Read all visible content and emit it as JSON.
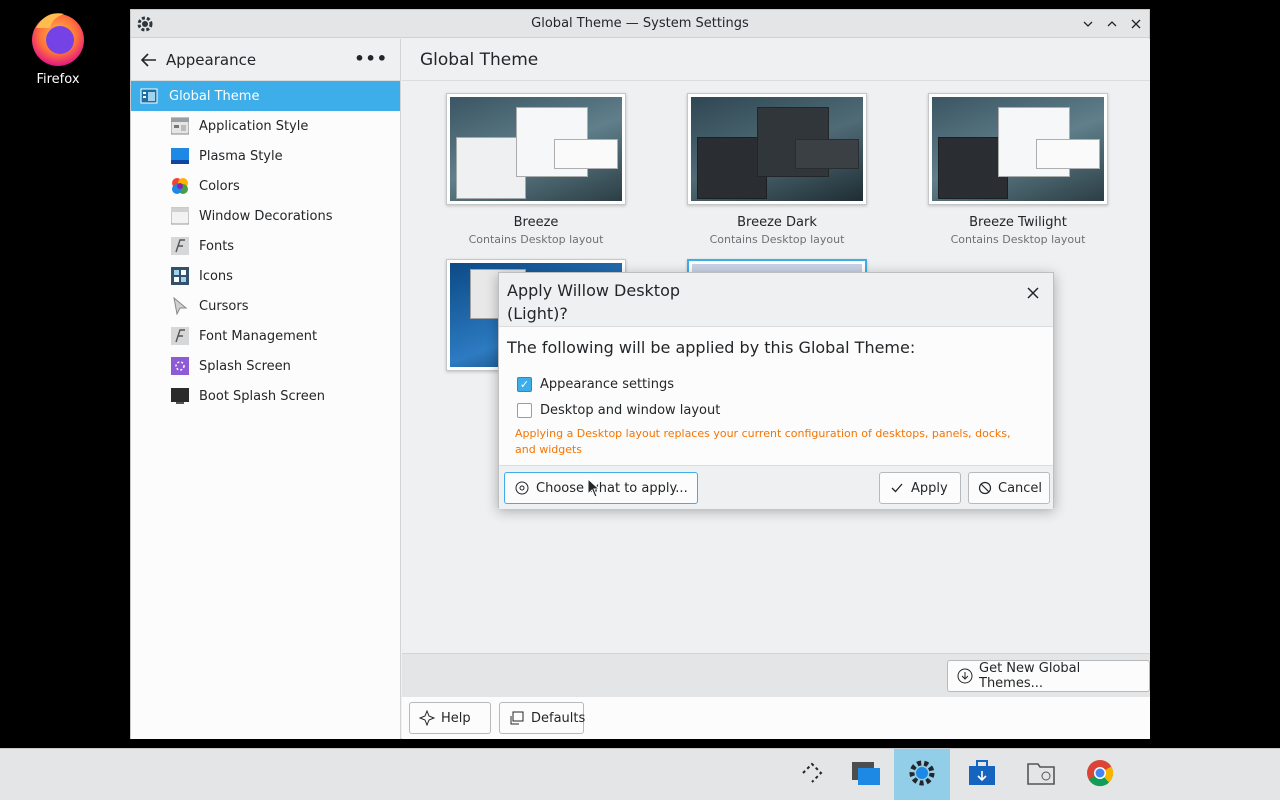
{
  "desktop": {
    "firefox_label": "Firefox"
  },
  "window": {
    "title": "Global Theme — System Settings",
    "controls": [
      "minimize",
      "maximize",
      "close"
    ]
  },
  "sidebar": {
    "header": "Appearance",
    "items": [
      {
        "label": "Global Theme",
        "icon": "global-theme-icon",
        "active": true
      },
      {
        "label": "Application Style",
        "icon": "application-style-icon"
      },
      {
        "label": "Plasma Style",
        "icon": "plasma-style-icon"
      },
      {
        "label": "Colors",
        "icon": "colors-icon"
      },
      {
        "label": "Window Decorations",
        "icon": "window-decorations-icon"
      },
      {
        "label": "Fonts",
        "icon": "fonts-icon"
      },
      {
        "label": "Icons",
        "icon": "icons-icon"
      },
      {
        "label": "Cursors",
        "icon": "cursors-icon"
      },
      {
        "label": "Font Management",
        "icon": "font-management-icon"
      },
      {
        "label": "Splash Screen",
        "icon": "splash-screen-icon"
      },
      {
        "label": "Boot Splash Screen",
        "icon": "boot-splash-icon"
      }
    ]
  },
  "main": {
    "title": "Global Theme",
    "themes": [
      {
        "name": "Breeze",
        "subtitle": "Contains Desktop layout"
      },
      {
        "name": "Breeze Dark",
        "subtitle": "Contains Desktop layout"
      },
      {
        "name": "Breeze Twilight",
        "subtitle": "Contains Desktop layout"
      }
    ],
    "get_new_label": "Get New Global Themes...",
    "help_label": "Help",
    "defaults_label": "Defaults"
  },
  "dialog": {
    "title": "Apply Willow Desktop (Light)?",
    "intro": "The following will be applied by this Global Theme:",
    "options": [
      {
        "label": "Appearance settings",
        "checked": true
      },
      {
        "label": "Desktop and window layout",
        "checked": false
      }
    ],
    "warning": "Applying a Desktop layout replaces your current configuration of desktops, panels, docks, and widgets",
    "choose_label": "Choose what to apply...",
    "apply_label": "Apply",
    "cancel_label": "Cancel"
  },
  "colors": {
    "accent": "#3daee9",
    "warning": "#f67400"
  }
}
